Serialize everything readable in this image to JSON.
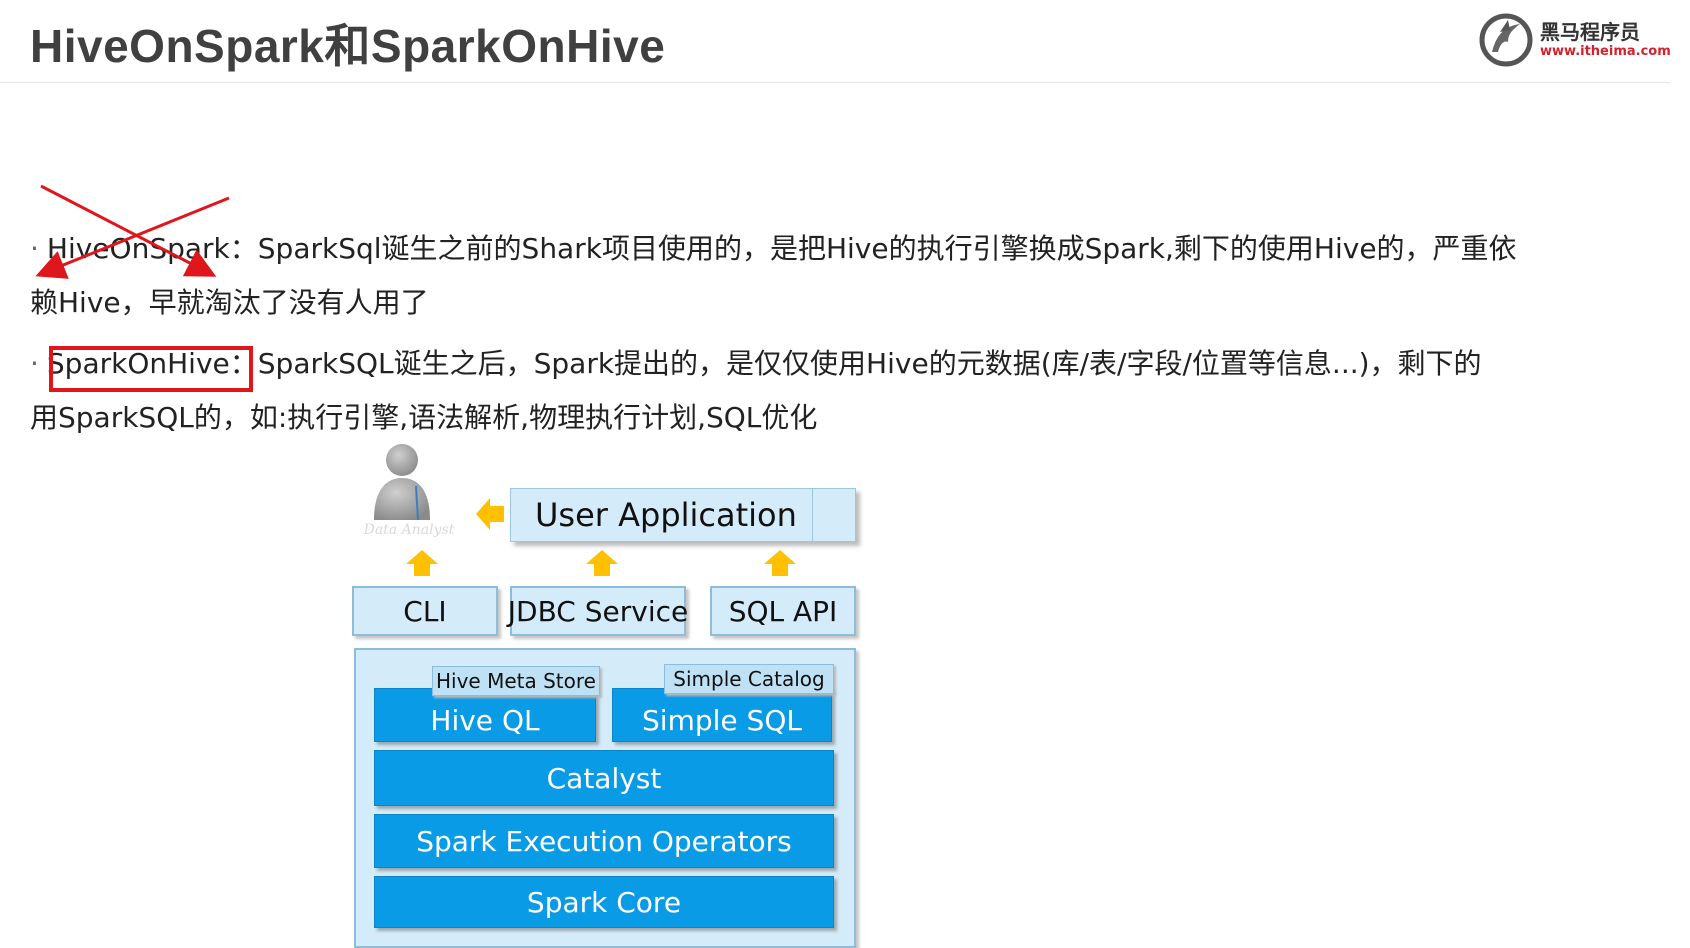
{
  "header": {
    "title": "HiveOnSpark和SparkOnHive",
    "logo_name": "黑马程序员",
    "logo_url": "www.itheima.com"
  },
  "content": {
    "bullet": "·",
    "item1": {
      "term": "HiveOnSpark",
      "colon": "：",
      "text_line1": "SparkSql诞生之前的Shark项目使用的，是把Hive的执行引擎换成Spark,剩下的使用Hive的，严重依",
      "text_line2": "赖Hive，早就淘汰了没有人用了"
    },
    "item2": {
      "term": "SparkOnHive",
      "colon": "：",
      "text_line1": "SparkSQL诞生之后，Spark提出的，是仅仅使用Hive的元数据(库/表/字段/位置等信息...)，剩下的",
      "text_line2": "用SparkSQL的，如:执行引擎,语法解析,物理执行计划,SQL优化"
    }
  },
  "diagram": {
    "user_label": "Data Analyst",
    "user_app": "User Application",
    "services": [
      "CLI",
      "JDBC Service",
      "SQL API"
    ],
    "hive_meta_store": "Hive Meta Store",
    "simple_catalog": "Simple Catalog",
    "hive_ql": "Hive QL",
    "simple_sql": "Simple SQL",
    "catalyst": "Catalyst",
    "execution_operators": "Spark Execution Operators",
    "spark_core": "Spark Core"
  },
  "colors": {
    "accent_red": "#e0161d",
    "block_blue": "#0a9be6",
    "light_blue": "#d4ecf9",
    "arrow_orange": "#ffc000"
  }
}
